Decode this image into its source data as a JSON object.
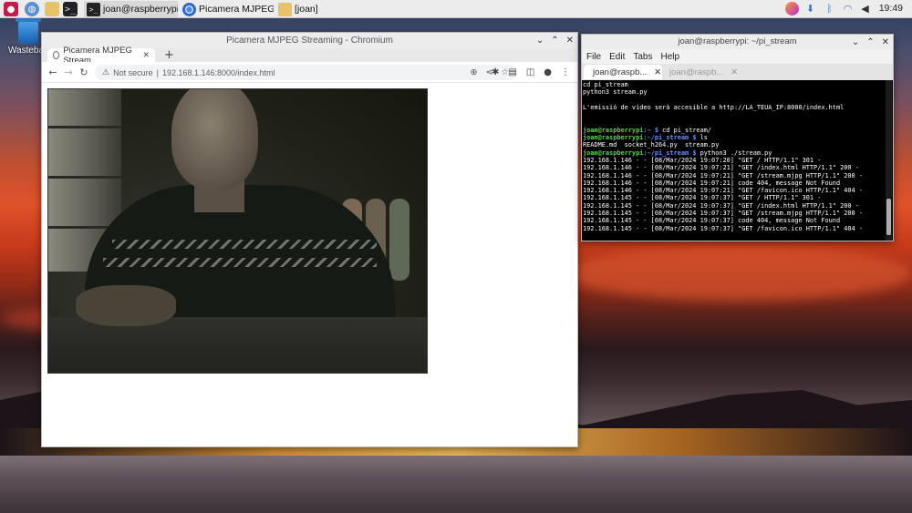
{
  "taskbar": {
    "tasks": [
      {
        "label": "joan@raspberrypi: ~/..."
      },
      {
        "label": "Picamera MJPEG Str..."
      },
      {
        "label": "[joan]"
      }
    ],
    "clock": "19:49"
  },
  "desktop": {
    "icons": [
      {
        "label": "Wastebas"
      }
    ]
  },
  "browser": {
    "window_title": "Picamera MJPEG Streaming - Chromium",
    "tab_title": "Picamera MJPEG Stream",
    "new_tab": "+",
    "security_label": "Not secure",
    "url": "192.168.1.146:8000/index.html",
    "page": {
      "content": "mjpeg-camera-stream"
    }
  },
  "terminal": {
    "window_title": "joan@raspberrypi: ~/pi_stream",
    "menu": [
      "File",
      "Edit",
      "Tabs",
      "Help"
    ],
    "tabs": [
      {
        "label": "joan@raspb...",
        "active": true
      },
      {
        "label": "joan@raspb...",
        "active": false
      }
    ],
    "lines": [
      {
        "text": "cd pi_stream"
      },
      {
        "text": "python3 stream.py"
      },
      {
        "text": ""
      },
      {
        "text": "L'emissió de vídeo serà accesible a http://LA_TEUA_IP:8000/index.html"
      },
      {
        "text": ""
      },
      {
        "text": ""
      },
      {
        "prompt_user": "joan@raspberrypi",
        "prompt_dir": ":~ $",
        "cmd": " cd pi_stream/"
      },
      {
        "prompt_user": "joan@raspberrypi",
        "prompt_dir": ":~/pi_stream $",
        "cmd": " ls"
      },
      {
        "text": "README.md  socket_h264.py  stream.py"
      },
      {
        "prompt_user": "joan@raspberrypi",
        "prompt_dir": ":~/pi_stream $",
        "cmd": " python3 ./stream.py"
      },
      {
        "text": "192.168.1.146 - - [08/Mar/2024 19:07:20] \"GET / HTTP/1.1\" 301 -"
      },
      {
        "text": "192.168.1.146 - - [08/Mar/2024 19:07:21] \"GET /index.html HTTP/1.1\" 200 -"
      },
      {
        "text": "192.168.1.146 - - [08/Mar/2024 19:07:21] \"GET /stream.mjpg HTTP/1.1\" 200 -"
      },
      {
        "text": "192.168.1.146 - - [08/Mar/2024 19:07:21] code 404, message Not Found"
      },
      {
        "text": "192.168.1.146 - - [08/Mar/2024 19:07:21] \"GET /favicon.ico HTTP/1.1\" 404 -"
      },
      {
        "text": "192.168.1.145 - - [08/Mar/2024 19:07:37] \"GET / HTTP/1.1\" 301 -"
      },
      {
        "text": "192.168.1.145 - - [08/Mar/2024 19:07:37] \"GET /index.html HTTP/1.1\" 200 -"
      },
      {
        "text": "192.168.1.145 - - [08/Mar/2024 19:07:37] \"GET /stream.mjpg HTTP/1.1\" 200 -"
      },
      {
        "text": "192.168.1.145 - - [08/Mar/2024 19:07:37] code 404, message Not Found"
      },
      {
        "text": "192.168.1.145 - - [08/Mar/2024 19:07:37] \"GET /favicon.ico HTTP/1.1\" 404 -"
      },
      {
        "text": ""
      }
    ]
  },
  "colors": {
    "prompt_user": "#4fd64f",
    "prompt_dir": "#6a8cff",
    "taskbar": "#ececec"
  }
}
